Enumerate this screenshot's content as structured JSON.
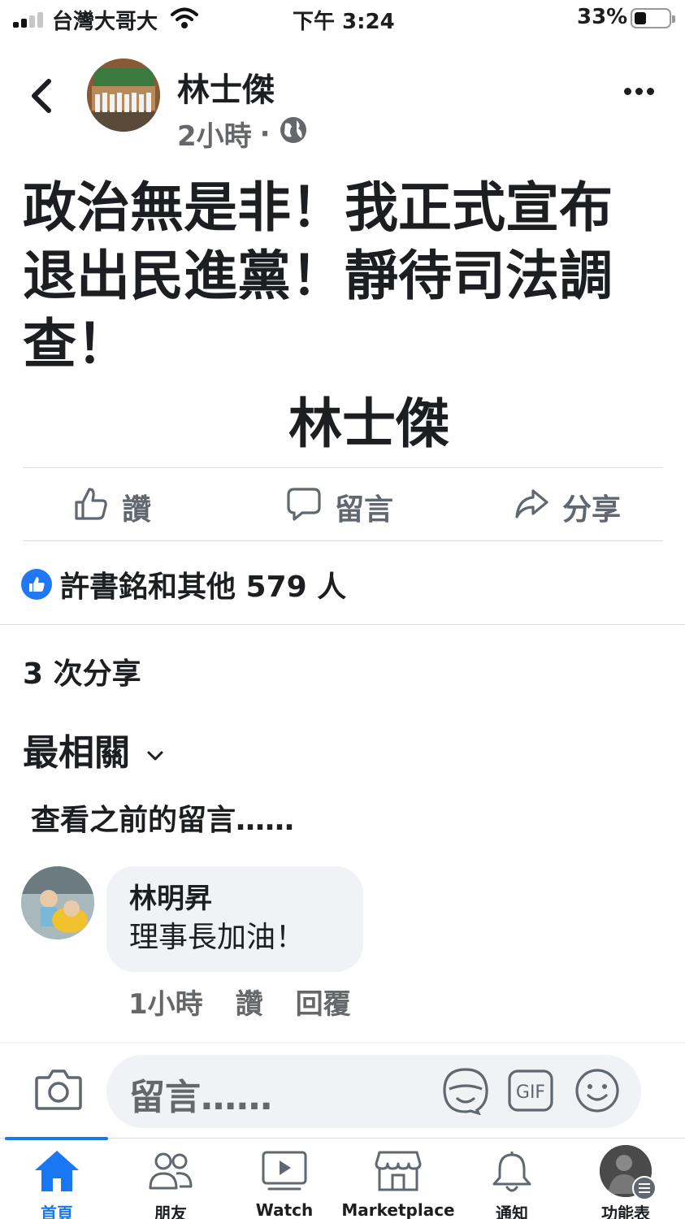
{
  "status_bar": {
    "carrier": "台灣大哥大",
    "time": "下午 3:24",
    "battery_percent": "33%",
    "battery_level": 0.33
  },
  "header": {
    "author": "林士傑",
    "time_ago": "2小時",
    "separator": "·"
  },
  "post": {
    "text": "政治無是非！我正式宣布退出民進黨！靜待司法調查！",
    "signature": "林士傑"
  },
  "actions": {
    "like": "讚",
    "comment": "留言",
    "share": "分享"
  },
  "reactions": {
    "text": "許書銘和其他 579 人"
  },
  "shares": {
    "text": "3 次分享"
  },
  "sort": {
    "label": "最相關"
  },
  "view_previous": "查看之前的留言……",
  "comments": [
    {
      "name": "林明昇",
      "text": "理事長加油！",
      "time_ago": "1小時",
      "like": "讚",
      "reply": "回覆"
    }
  ],
  "composer": {
    "placeholder": "留言……"
  },
  "tabbar": {
    "items": [
      {
        "label": "首頁",
        "icon": "home-icon",
        "active": true
      },
      {
        "label": "朋友",
        "icon": "friends-icon"
      },
      {
        "label": "Watch",
        "icon": "watch-icon"
      },
      {
        "label": "Marketplace",
        "icon": "marketplace-icon"
      },
      {
        "label": "通知",
        "icon": "bell-icon"
      },
      {
        "label": "功能表",
        "icon": "menu-icon"
      }
    ]
  },
  "colors": {
    "accent": "#1877f2",
    "secondary_text": "#65676b",
    "bubble_bg": "#f0f2f5"
  }
}
